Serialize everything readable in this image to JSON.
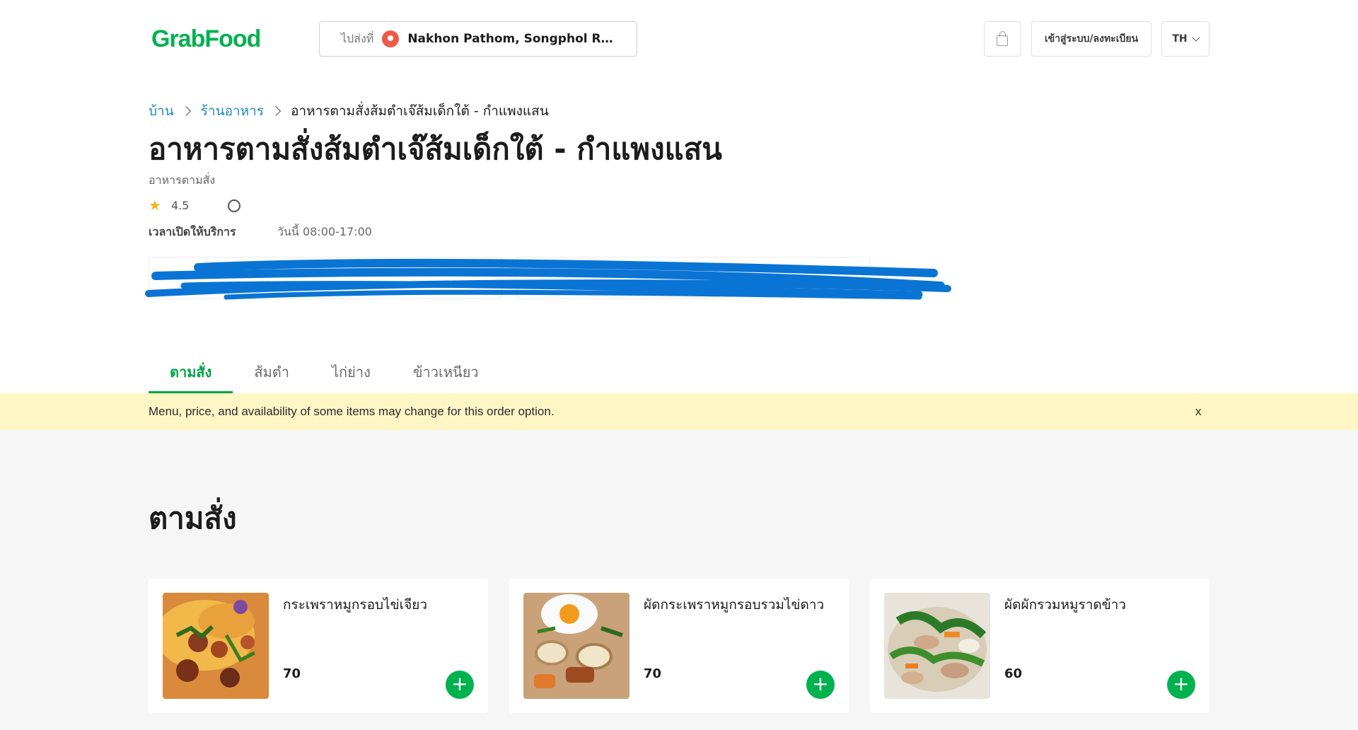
{
  "header": {
    "logo": "GrabFood",
    "address_prefix": "ไปส่งที่",
    "address_value": "Nakhon Pathom, Songphol Rd, K...",
    "login_label": "เข้าสู่ระบบ/ลงทะเบียน",
    "language": "TH"
  },
  "breadcrumb": {
    "home": "บ้าน",
    "restaurants": "ร้านอาหาร",
    "current": "อาหารตามสั่งส้มตำเจ๊ส้มเด็กใต้ - กำแพงแสน"
  },
  "restaurant": {
    "name": "อาหารตามสั่งส้มตำเจ๊ส้มเด็กใต้ - กำแพงแสน",
    "cuisine": "อาหารตามสั่ง",
    "rating": "4.5",
    "hours_label": "เวลาเปิดให้บริการ",
    "hours_value": "วันนี้  08:00-17:00"
  },
  "tabs": [
    {
      "label": "ตามสั่ง",
      "active": true
    },
    {
      "label": "ส้มตำ",
      "active": false
    },
    {
      "label": "ไก่ย่าง",
      "active": false
    },
    {
      "label": "ข้าวเหนียว",
      "active": false
    }
  ],
  "notice": {
    "text": "Menu, price, and availability of some items may change for this order option.",
    "close": "x"
  },
  "menu": {
    "section_title": "ตามสั่ง",
    "items": [
      {
        "name": "กระเพราหมูกรอบไข่เจียว",
        "price": "70",
        "add": "+"
      },
      {
        "name": "ผัดกระเพราหมูกรอบรวมไข่ดาว",
        "price": "70",
        "add": "+"
      },
      {
        "name": "ผัดผักรวมหมูราดข้าว",
        "price": "60",
        "add": "+"
      }
    ]
  },
  "colors": {
    "brand_green": "#00b14f",
    "link_blue": "#1e88c7",
    "notice_bg": "#fff6c6",
    "redaction_blue": "#0a74d4"
  },
  "icons": [
    "location-pin-icon",
    "shopping-bag-icon",
    "chevron-down-icon",
    "chevron-right-icon",
    "star-icon",
    "clock-icon",
    "plus-icon"
  ]
}
